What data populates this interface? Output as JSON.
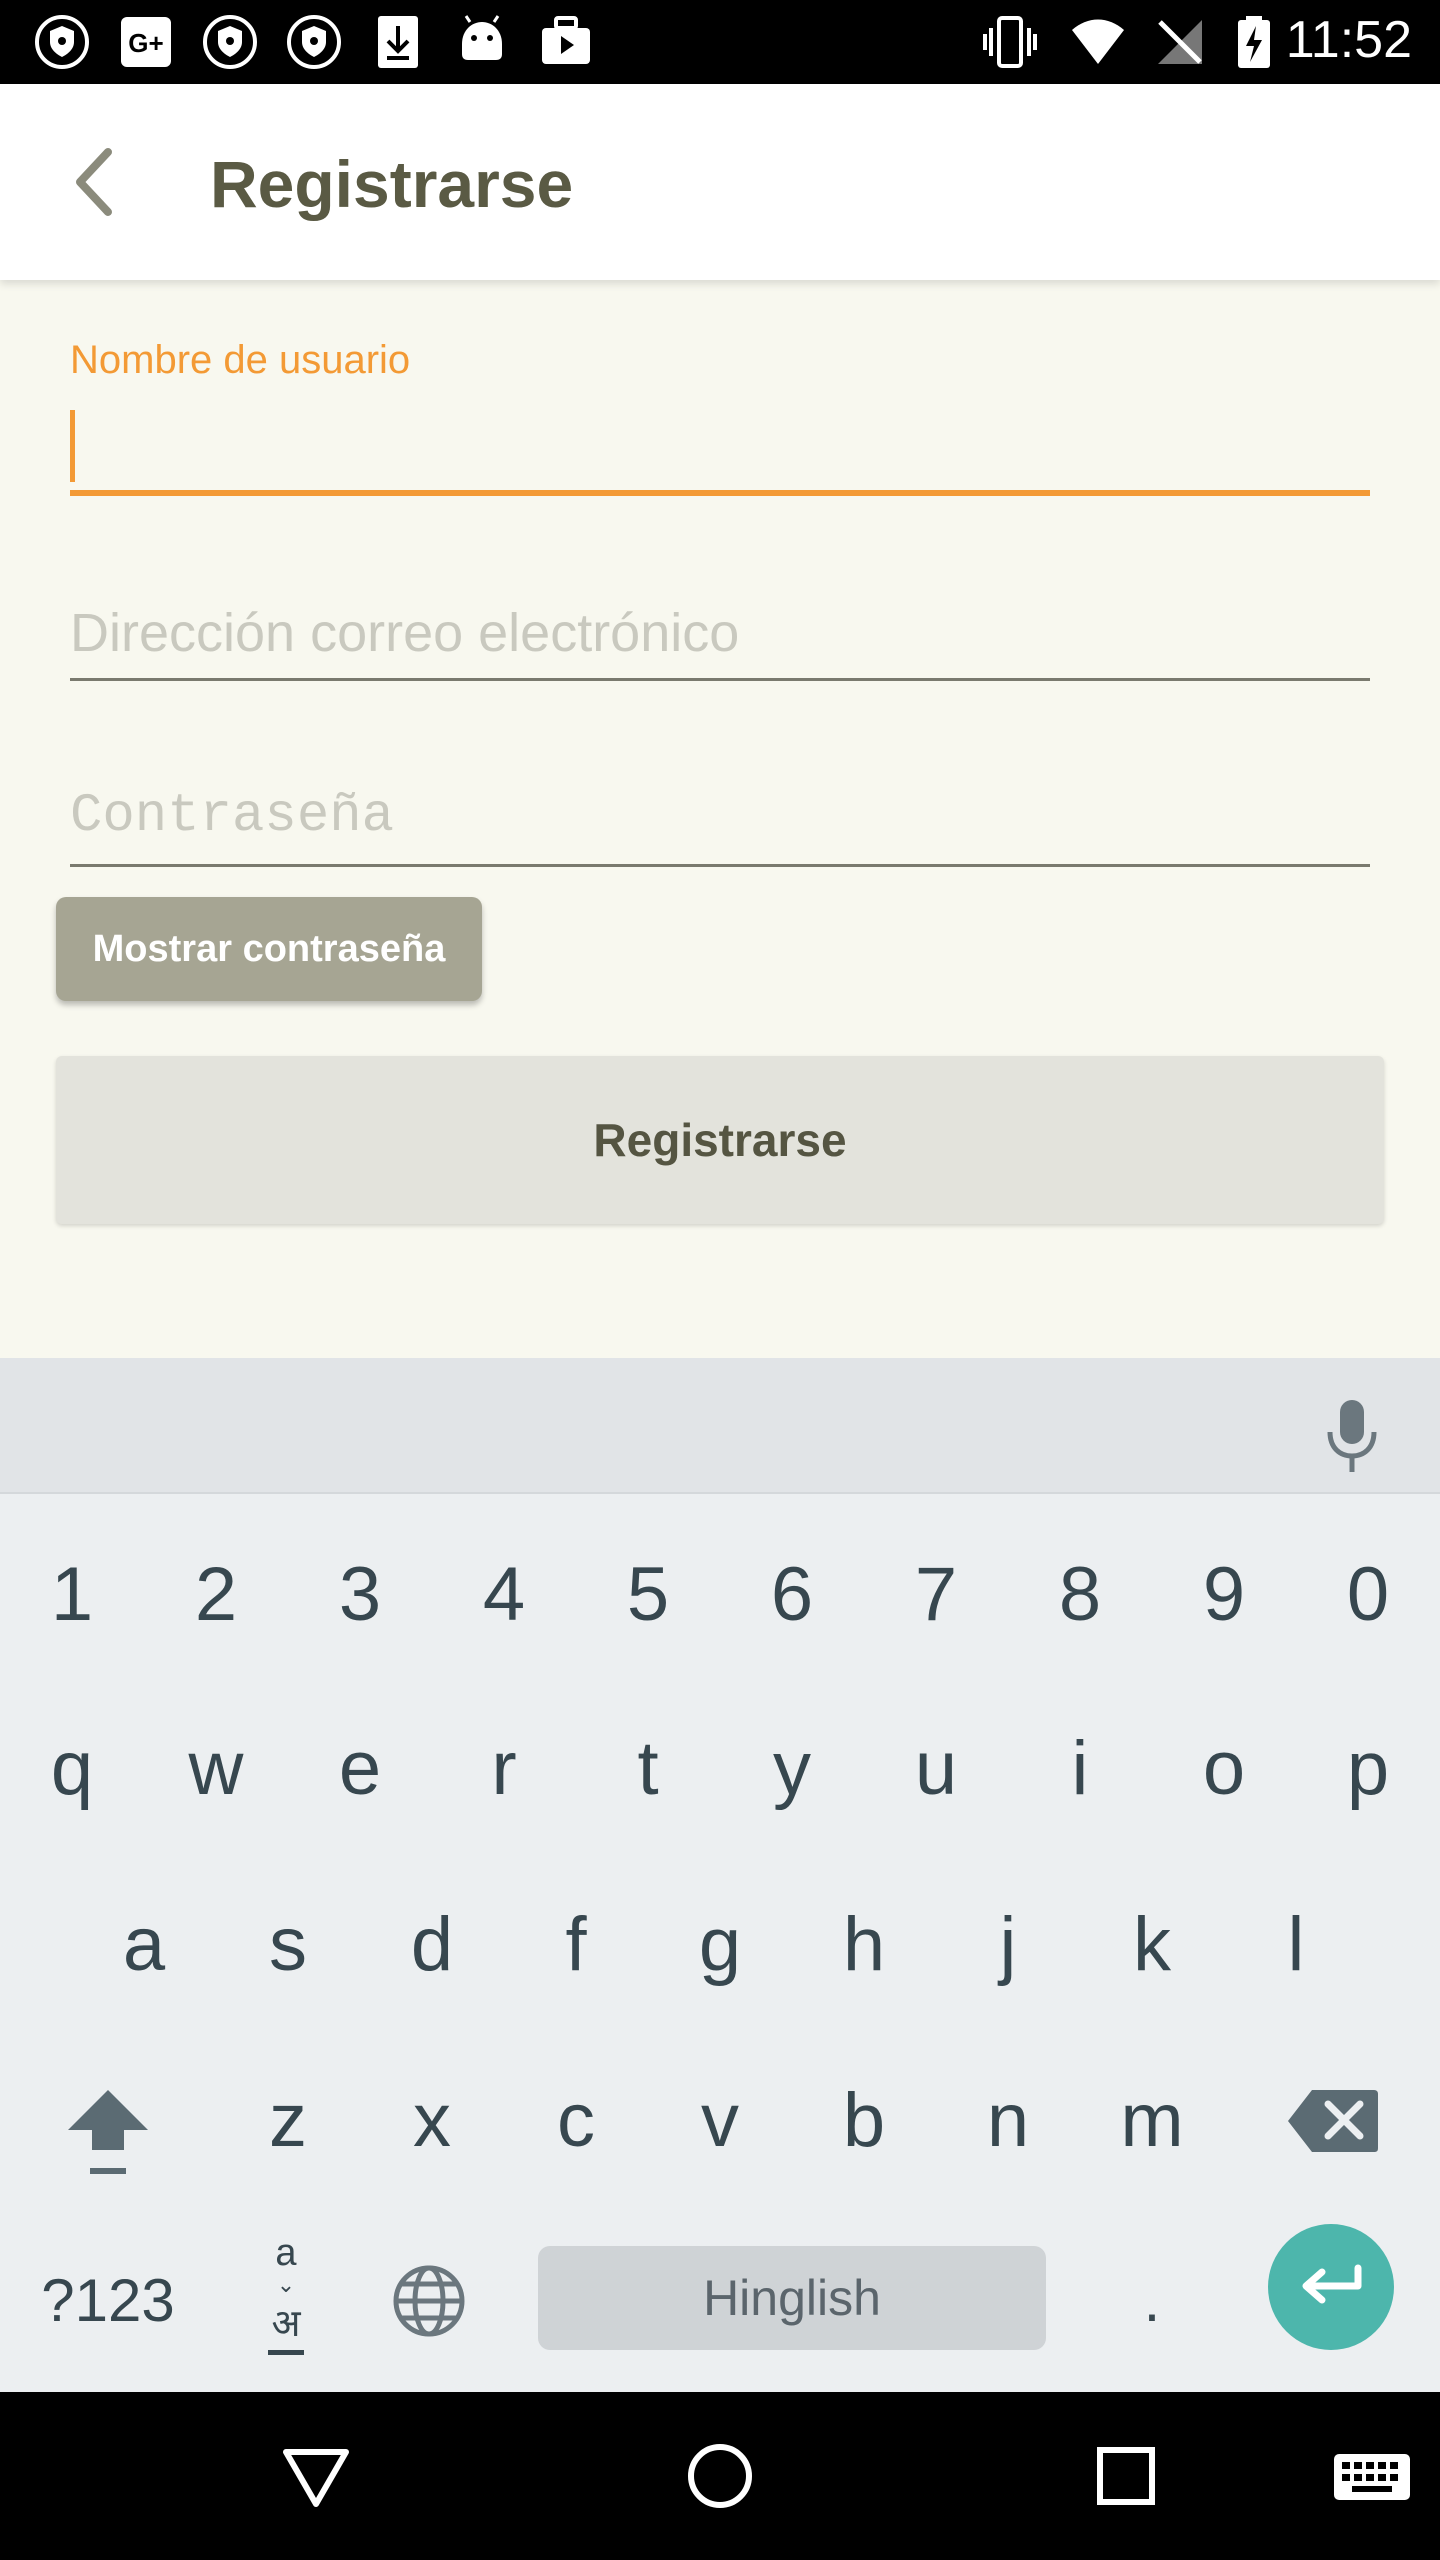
{
  "status_bar": {
    "time": "11:52",
    "left_icons": [
      "shield-icon",
      "google-plus-icon",
      "shield-icon",
      "shield-icon",
      "download-icon",
      "android-icon",
      "briefcase-play-icon"
    ],
    "right_icons": [
      "vibrate-icon",
      "wifi-icon",
      "no-signal-icon",
      "battery-charging-icon"
    ]
  },
  "app_bar": {
    "back_icon": "chevron-left-icon",
    "title": "Registrarse"
  },
  "form": {
    "username": {
      "label": "Nombre de usuario",
      "value": ""
    },
    "email": {
      "placeholder": "Dirección correo electrónico",
      "value": ""
    },
    "password": {
      "placeholder": "Contraseña",
      "value": ""
    },
    "show_password_label": "Mostrar contraseña",
    "register_label": "Registrarse"
  },
  "colors": {
    "accent": "#f39a35",
    "content_bg": "#f8f8ef",
    "title_text": "#5a5a44",
    "show_button_bg": "#a6a593",
    "register_button_bg": "#e3e3dc",
    "enter_key": "#4db6ac"
  },
  "keyboard": {
    "row_numbers": [
      "1",
      "2",
      "3",
      "4",
      "5",
      "6",
      "7",
      "8",
      "9",
      "0"
    ],
    "row1": [
      "q",
      "w",
      "e",
      "r",
      "t",
      "y",
      "u",
      "i",
      "o",
      "p"
    ],
    "row2": [
      "a",
      "s",
      "d",
      "f",
      "g",
      "h",
      "j",
      "k",
      "l"
    ],
    "row3": [
      "z",
      "x",
      "c",
      "v",
      "b",
      "n",
      "m"
    ],
    "symbols_label": "?123",
    "lang_top": "a",
    "lang_bottom": "अ",
    "space_label": "Hinglish",
    "period": "."
  },
  "nav_bar": {
    "icons": [
      "back-triangle-icon",
      "home-circle-icon",
      "recents-square-icon",
      "keyboard-switch-icon"
    ]
  }
}
